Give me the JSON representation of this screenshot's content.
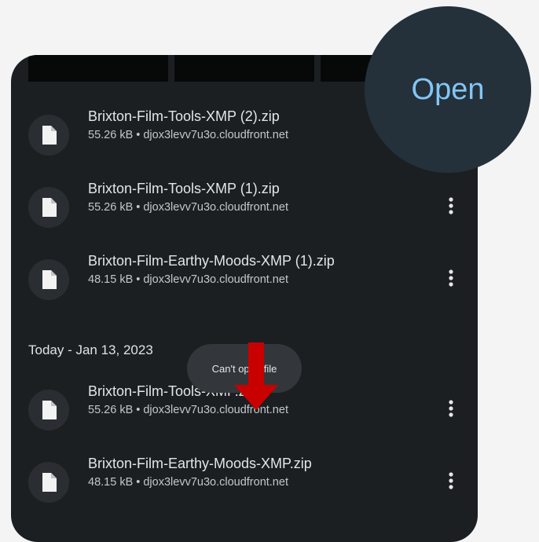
{
  "files": [
    {
      "name": "Brixton-Film-Tools-XMP (2).zip",
      "meta": "55.26 kB • djox3levv7u3o.cloudfront.net"
    },
    {
      "name": "Brixton-Film-Tools-XMP (1).zip",
      "meta": "55.26 kB • djox3levv7u3o.cloudfront.net"
    },
    {
      "name": "Brixton-Film-Earthy-Moods-XMP (1).zip",
      "meta": "48.15 kB • djox3levv7u3o.cloudfront.net"
    }
  ],
  "section": {
    "label": "Today - Jan 13, 2023"
  },
  "today_files": [
    {
      "name": "Brixton-Film-Tools-XMP.zip",
      "meta": "55.26 kB • djox3levv7u3o.cloudfront.net"
    },
    {
      "name": "Brixton-Film-Earthy-Moods-XMP.zip",
      "meta": "48.15 kB • djox3levv7u3o.cloudfront.net"
    }
  ],
  "toast": {
    "text": "Can't open file"
  },
  "open_button": {
    "label": "Open"
  },
  "icons": {
    "file": "file-icon",
    "more": "more-vert-icon",
    "arrow": "arrow-down-icon"
  },
  "colors": {
    "accent": "#84c5f5",
    "annotation_arrow": "#c80000"
  }
}
